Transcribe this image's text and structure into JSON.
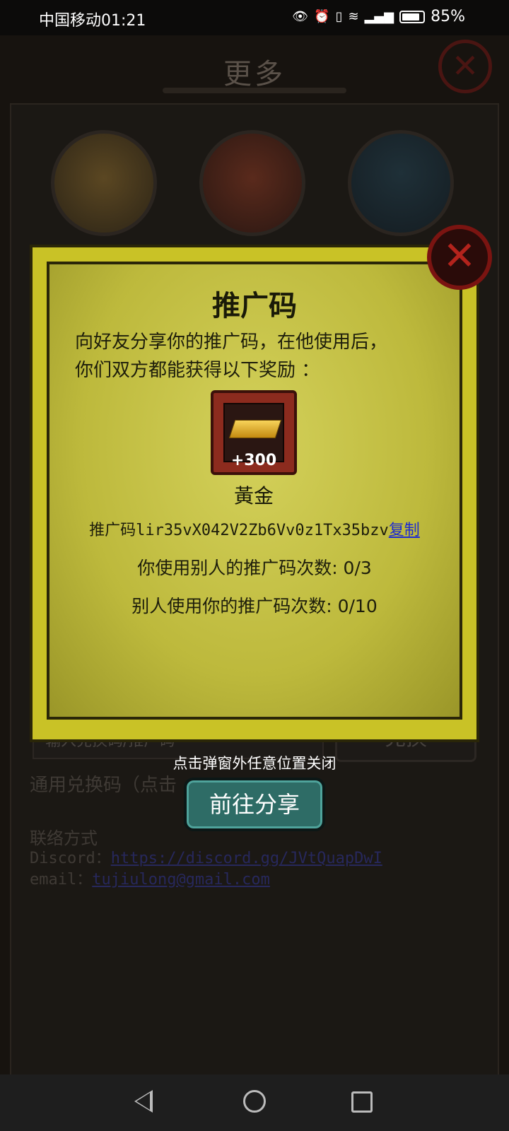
{
  "status_bar": {
    "carrier_time": "中国移动01:21",
    "battery": "85%",
    "icons": [
      "eye-icon",
      "alarm-icon",
      "vibrate-icon",
      "wifi-icon",
      "signal-icon",
      "battery-icon"
    ]
  },
  "background": {
    "title": "更多",
    "redeem_placeholder": "输入兑换码/推广码",
    "redeem_button": "兑换",
    "generic_code": "通用兑换码（点击",
    "contact_title": "联络方式",
    "discord_label": "Discord：",
    "discord_link": "https://discord.gg/JVtQuapDwI",
    "email_label": "email：",
    "email_link": "tujiulong@gmail.com"
  },
  "modal": {
    "title": "推广码",
    "desc_line1": "向好友分享你的推广码，在他使用后，",
    "desc_line2": "你们双方都能获得以下奖励 ：",
    "reward_count": "+300",
    "reward_name": "黃金",
    "code_label": "推广码lir35vX042V2Zb6Vv0z1Tx35bzv",
    "copy_label": "复制",
    "used_others": "你使用别人的推广码次数: 0/3",
    "others_used": "别人使用你的推广码次数: 0/10",
    "hint": "点击弹窗外任意位置关闭",
    "share_button": "前往分享"
  }
}
